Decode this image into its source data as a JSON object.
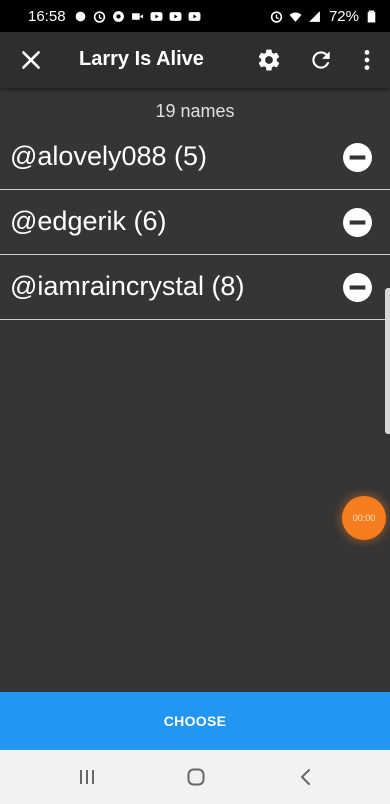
{
  "status_bar": {
    "time": "16:58",
    "battery": "72%",
    "left_icons": [
      "notification-icon",
      "alarm-icon",
      "chrome-icon",
      "video-icon",
      "youtube-icon",
      "youtube-icon",
      "youtube-icon"
    ],
    "right_icons": [
      "alarm-icon",
      "wifi-icon",
      "signal-icon",
      "battery-icon"
    ]
  },
  "app_bar": {
    "title": "Larry Is Alive",
    "icons": [
      "close-icon",
      "gear-icon",
      "refresh-icon",
      "more-vert-icon"
    ]
  },
  "list": {
    "count_label": "19 names",
    "items": [
      {
        "label": "@alovely088 (5)"
      },
      {
        "label": "@edgerik (6)"
      },
      {
        "label": "@iamraincrystal (8)"
      }
    ]
  },
  "timer": {
    "label": "00:00"
  },
  "actions": {
    "choose_label": "CHOOSE"
  },
  "colors": {
    "background": "#353535",
    "app_bar": "#2e2e2e",
    "accent": "#2196f3",
    "timer": "#f57c1f"
  }
}
